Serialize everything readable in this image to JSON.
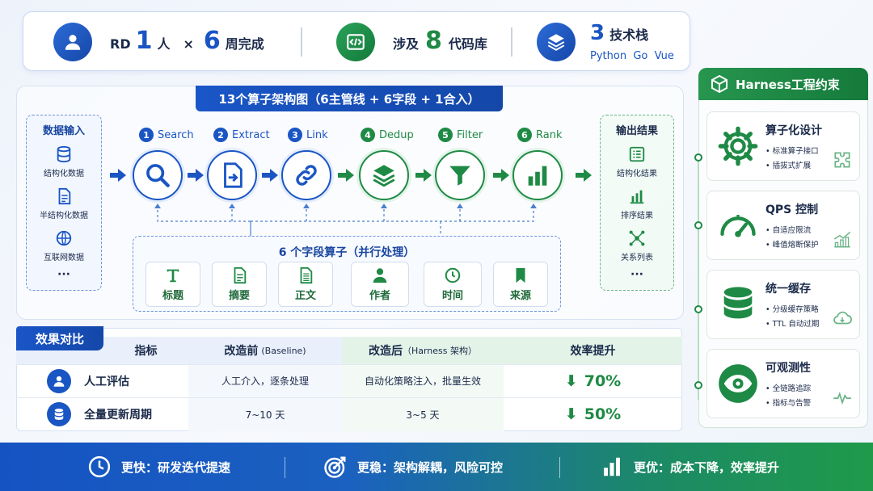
{
  "top_stats": {
    "rd_prefix": "RD",
    "rd_count": "1",
    "rd_unit": "人",
    "times": "×",
    "weeks_count": "6",
    "weeks_unit": "周完成",
    "repos_prefix": "涉及",
    "repos_count": "8",
    "repos_unit": "代码库",
    "stack_count": "3",
    "stack_unit": "技术栈",
    "stack_langs": "Python  Go  Vue"
  },
  "diagram": {
    "title": "13个算子架构图（6主管线 + 6字段 + 1合入）",
    "input": {
      "title": "数据输入",
      "items": [
        "结构化数据",
        "半结构化数据",
        "互联网数据"
      ],
      "more": "···"
    },
    "steps": [
      {
        "num": "1",
        "label": "Search",
        "icon": "search-icon"
      },
      {
        "num": "2",
        "label": "Extract",
        "icon": "extract-icon"
      },
      {
        "num": "3",
        "label": "Link",
        "icon": "link-icon"
      },
      {
        "num": "4",
        "label": "Dedup",
        "icon": "layers-icon"
      },
      {
        "num": "5",
        "label": "Filter",
        "icon": "filter-icon"
      },
      {
        "num": "6",
        "label": "Rank",
        "icon": "bar-chart-icon"
      }
    ],
    "fields": {
      "title": "6 个字段算子（并行处理）",
      "items": [
        "标题",
        "摘要",
        "正文",
        "作者",
        "时间",
        "来源"
      ]
    },
    "output": {
      "title": "输出结果",
      "items": [
        "结构化结果",
        "排序结果",
        "关系列表"
      ],
      "more": "···"
    }
  },
  "results": {
    "tag": "效果对比",
    "headers": {
      "metric": "指标",
      "before": "改造前",
      "before_sub": "(Baseline)",
      "after": "改造后",
      "after_sub": "（Harness 架构）",
      "eff": "效率提升"
    },
    "rows": [
      {
        "name": "人工评估",
        "before": "人工介入，逐条处理",
        "after": "自动化策略注入，批量生效",
        "eff": "70%"
      },
      {
        "name": "全量更新周期",
        "before": "7~10 天",
        "after": "3~5 天",
        "eff": "50%"
      }
    ],
    "down_arrow": "⬇"
  },
  "harness": {
    "title": "Harness工程约束",
    "cards": [
      {
        "title": "算子化设计",
        "b1": "• 标准算子接口",
        "b2": "• 插拔式扩展"
      },
      {
        "title": "QPS 控制",
        "b1": "• 自适应限流",
        "b2": "• 峰值熔断保护"
      },
      {
        "title": "统一缓存",
        "b1": "• 分级缓存策略",
        "b2": "• TTL 自动过期"
      },
      {
        "title": "可观测性",
        "b1": "• 全链路追踪",
        "b2": "• 指标与告警"
      }
    ]
  },
  "bottom": {
    "items": [
      "更快：研发迭代提速",
      "更稳：架构解耦，风险可控",
      "更优：成本下降，效率提升"
    ]
  },
  "colors": {
    "blue": "#1a55c4",
    "green": "#1f8a45"
  }
}
